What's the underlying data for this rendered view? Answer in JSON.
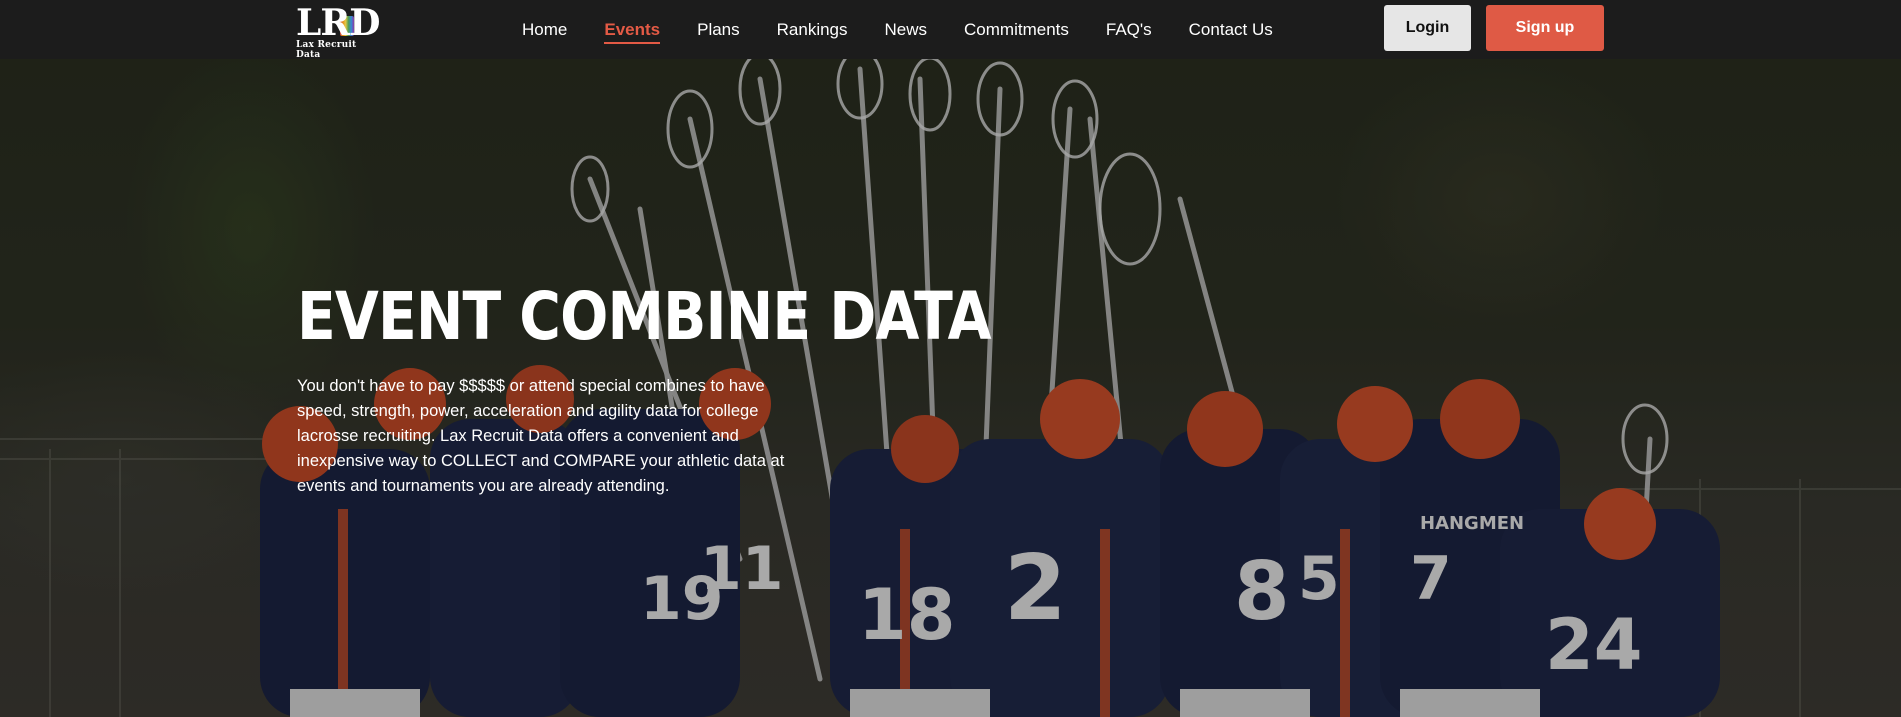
{
  "logo": {
    "mark": "LRD",
    "subtitle": "Lax Recruit Data"
  },
  "nav": {
    "items": [
      {
        "label": "Home",
        "active": false
      },
      {
        "label": "Events",
        "active": true
      },
      {
        "label": "Plans",
        "active": false
      },
      {
        "label": "Rankings",
        "active": false
      },
      {
        "label": "News",
        "active": false
      },
      {
        "label": "Commitments",
        "active": false
      },
      {
        "label": "FAQ's",
        "active": false
      },
      {
        "label": "Contact Us",
        "active": false
      }
    ],
    "login_label": "Login",
    "signup_label": "Sign up"
  },
  "hero": {
    "title": "EVENT COMBINE DATA",
    "description": "You don't have to pay $$$$$ or attend special combines to have speed, strength, power, acceleration and agility data for college lacrosse recruiting. Lax Recruit Data offers a convenient and inexpensive way to COLLECT and COMPARE your athletic data at events and tournaments you are already attending.",
    "photo_jersey_numbers": [
      "18",
      "2",
      "8",
      "5",
      "7",
      "24",
      "11",
      "19"
    ],
    "jersey_text": "HANGMEN"
  },
  "colors": {
    "accent": "#df5a45",
    "nav_bg": "#1c1c1c",
    "jersey": "#1d2444",
    "helmet": "#d2512b"
  }
}
